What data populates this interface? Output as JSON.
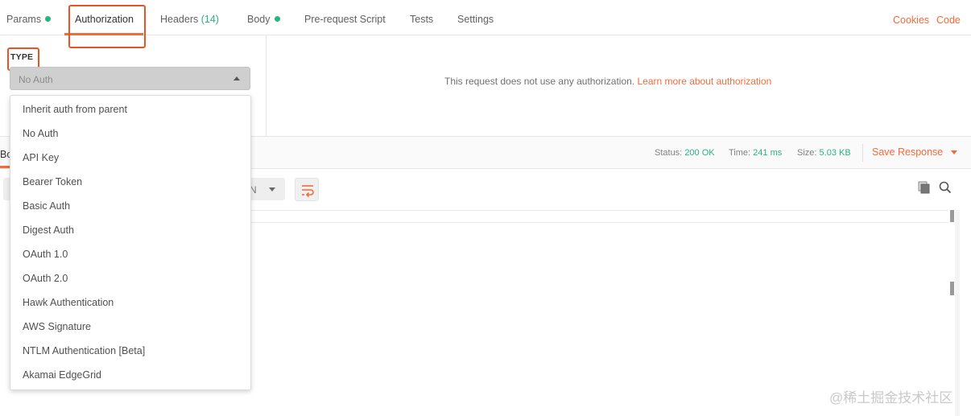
{
  "tabs": {
    "params": "Params",
    "authorization": "Authorization",
    "headers": "Headers",
    "headers_count": "(14)",
    "body": "Body",
    "prerequest": "Pre-request Script",
    "tests": "Tests",
    "settings": "Settings"
  },
  "top_links": {
    "cookies": "Cookies",
    "code": "Code"
  },
  "auth": {
    "type_label": "TYPE",
    "selected": "No Auth",
    "message": "This request does not use any authorization.",
    "learn_more": "Learn more about authorization"
  },
  "auth_menu": [
    "Inherit auth from parent",
    "No Auth",
    "API Key",
    "Bearer Token",
    "Basic Auth",
    "Digest Auth",
    "OAuth 1.0",
    "OAuth 2.0",
    "Hawk Authentication",
    "AWS Signature",
    "NTLM Authentication [Beta]",
    "Akamai EdgeGrid"
  ],
  "response": {
    "body_tab": "Bo",
    "status_label": "Status:",
    "status_value": "200 OK",
    "time_label": "Time:",
    "time_value": "241 ms",
    "size_label": "Size:",
    "size_value": "5.03 KB",
    "save_response": "Save Response",
    "format_value": "N"
  },
  "watermark": "@稀土掘金技术社区",
  "colors": {
    "accent": "#f26b3a",
    "success": "#26b47f",
    "highlight": "#e8542a"
  }
}
